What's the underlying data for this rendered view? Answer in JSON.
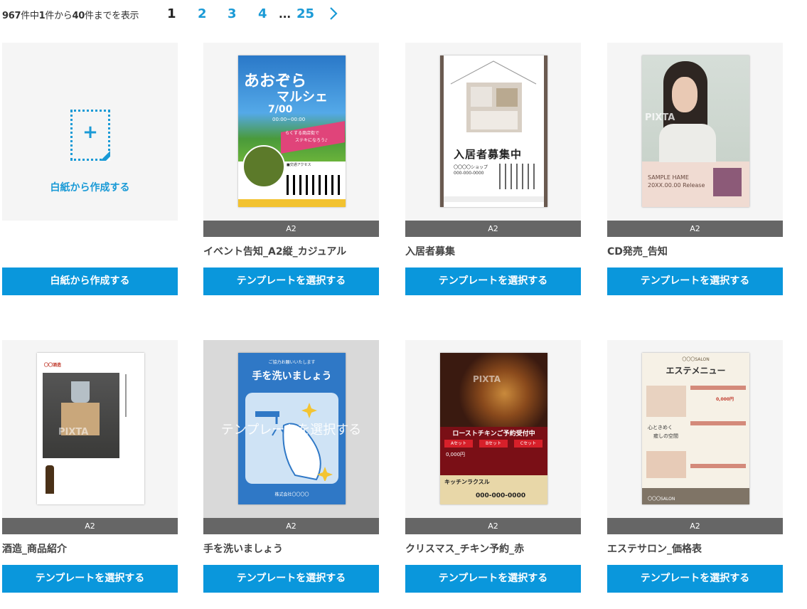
{
  "pagination": {
    "total": "967",
    "total_suffix": "件中",
    "from": "1",
    "from_suffix": "件から",
    "to": "40",
    "to_suffix": "件までを表示",
    "current_page": "1",
    "pages": [
      "2",
      "3",
      "4"
    ],
    "ellipsis": "...",
    "last_page": "25",
    "next_icon": "chevron-right-icon"
  },
  "blank": {
    "label": "白紙から作成する",
    "button": "白紙から作成する",
    "icon": "plus-icon"
  },
  "hover_overlay_label": "テンプレートを選択する",
  "cards": [
    {
      "size": "A2",
      "title": "イベント告知_A2縦_カジュアル",
      "button": "テンプレートを選択する",
      "poster_text": [
        "あおぞら",
        "マルシェ",
        "7/00",
        "00:00~00:00",
        "らくする商店街で",
        "ステキになろう♪",
        "■交通アクセス"
      ]
    },
    {
      "size": "A2",
      "title": "入居者募集",
      "button": "テンプレートを選択する",
      "poster_text": [
        "入居者募集中",
        "〇〇〇〇ショップ",
        "000-000-0000"
      ]
    },
    {
      "size": "A2",
      "title": "CD発売_告知",
      "button": "テンプレートを選択する",
      "poster_text": [
        "PIXTA",
        "SAMPLE HAME",
        "20XX.00.00 Release"
      ]
    },
    {
      "size": "A2",
      "title": "酒造_商品紹介",
      "button": "テンプレートを選択する",
      "poster_text": [
        "〇〇酒造",
        "PIXTA"
      ]
    },
    {
      "size": "A2",
      "title": "手を洗いましょう",
      "button": "テンプレートを選択する",
      "poster_text": [
        "ご協力お願いいたします",
        "手を洗いましょう",
        "株式会社〇〇〇〇"
      ]
    },
    {
      "size": "A2",
      "title": "クリスマス_チキン予約_赤",
      "button": "テンプレートを選択する",
      "poster_text": [
        "ローストチキンご予約受付中",
        "Aセット",
        "Bセット",
        "Cセット",
        "0,000円",
        "キッチンラクスル",
        "000-000-0000",
        "PIXTA"
      ]
    },
    {
      "size": "A2",
      "title": "エステサロン_価格表",
      "button": "テンプレートを選択する",
      "poster_text": [
        "〇〇〇SALON",
        "エステメニュー",
        "心ときめく",
        "癒しの空間",
        "0,000円",
        "〇〇〇SALON"
      ]
    }
  ],
  "colors": {
    "accent": "#0a97dc",
    "link": "#1a9ad6",
    "size_bar": "#666666",
    "thumb_bg": "#f5f5f5"
  }
}
